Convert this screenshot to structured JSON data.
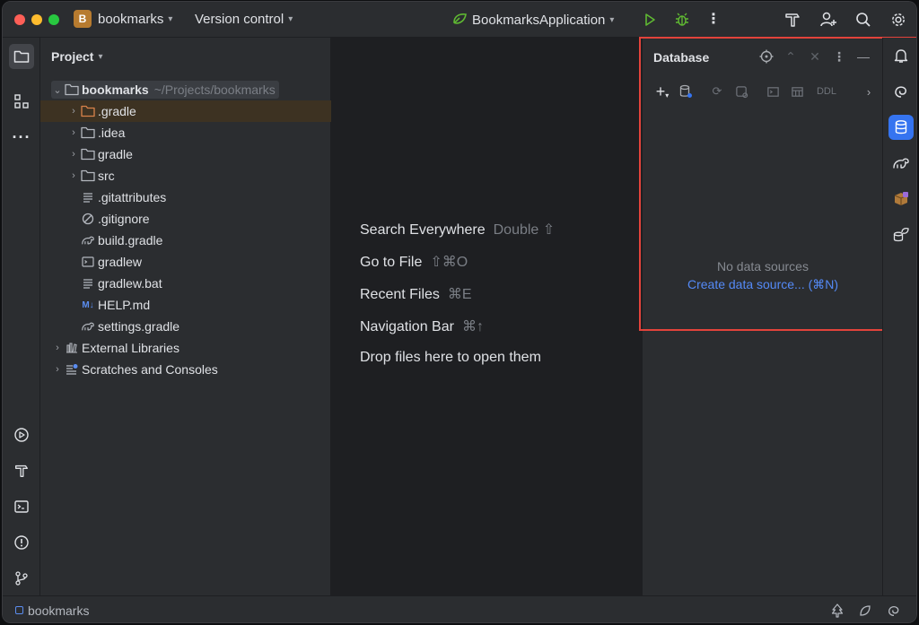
{
  "titlebar": {
    "project_badge": "B",
    "project_name": "bookmarks",
    "vcs": "Version control",
    "run_config": "BookmarksApplication"
  },
  "project_panel": {
    "title": "Project",
    "root": {
      "name": "bookmarks",
      "path": "~/Projects/bookmarks"
    },
    "items": [
      {
        "label": ".gradle",
        "type": "folder-orange",
        "expandable": true
      },
      {
        "label": ".idea",
        "type": "folder",
        "expandable": true
      },
      {
        "label": "gradle",
        "type": "folder",
        "expandable": true
      },
      {
        "label": "src",
        "type": "folder",
        "expandable": true
      },
      {
        "label": ".gitattributes",
        "type": "text-file",
        "expandable": false
      },
      {
        "label": ".gitignore",
        "type": "ignore-file",
        "expandable": false
      },
      {
        "label": "build.gradle",
        "type": "gradle-file",
        "expandable": false
      },
      {
        "label": "gradlew",
        "type": "shell-file",
        "expandable": false
      },
      {
        "label": "gradlew.bat",
        "type": "text-file",
        "expandable": false
      },
      {
        "label": "HELP.md",
        "type": "markdown-file",
        "expandable": false
      },
      {
        "label": "settings.gradle",
        "type": "gradle-file",
        "expandable": false
      }
    ],
    "external_libraries": "External Libraries",
    "scratches": "Scratches and Consoles"
  },
  "editor_hints": [
    {
      "label": "Search Everywhere",
      "key": "Double ⇧"
    },
    {
      "label": "Go to File",
      "key": "⇧⌘O"
    },
    {
      "label": "Recent Files",
      "key": "⌘E"
    },
    {
      "label": "Navigation Bar",
      "key": "⌘↑"
    },
    {
      "label": "Drop files here to open them",
      "key": ""
    }
  ],
  "database_panel": {
    "title": "Database",
    "ddl_label": "DDL",
    "empty_text": "No data sources",
    "create_link": "Create data source... (⌘N)"
  },
  "statusbar": {
    "project": "bookmarks"
  },
  "colors": {
    "accent": "#3574f0",
    "link": "#548af7",
    "highlight_outline": "#e3433b"
  }
}
